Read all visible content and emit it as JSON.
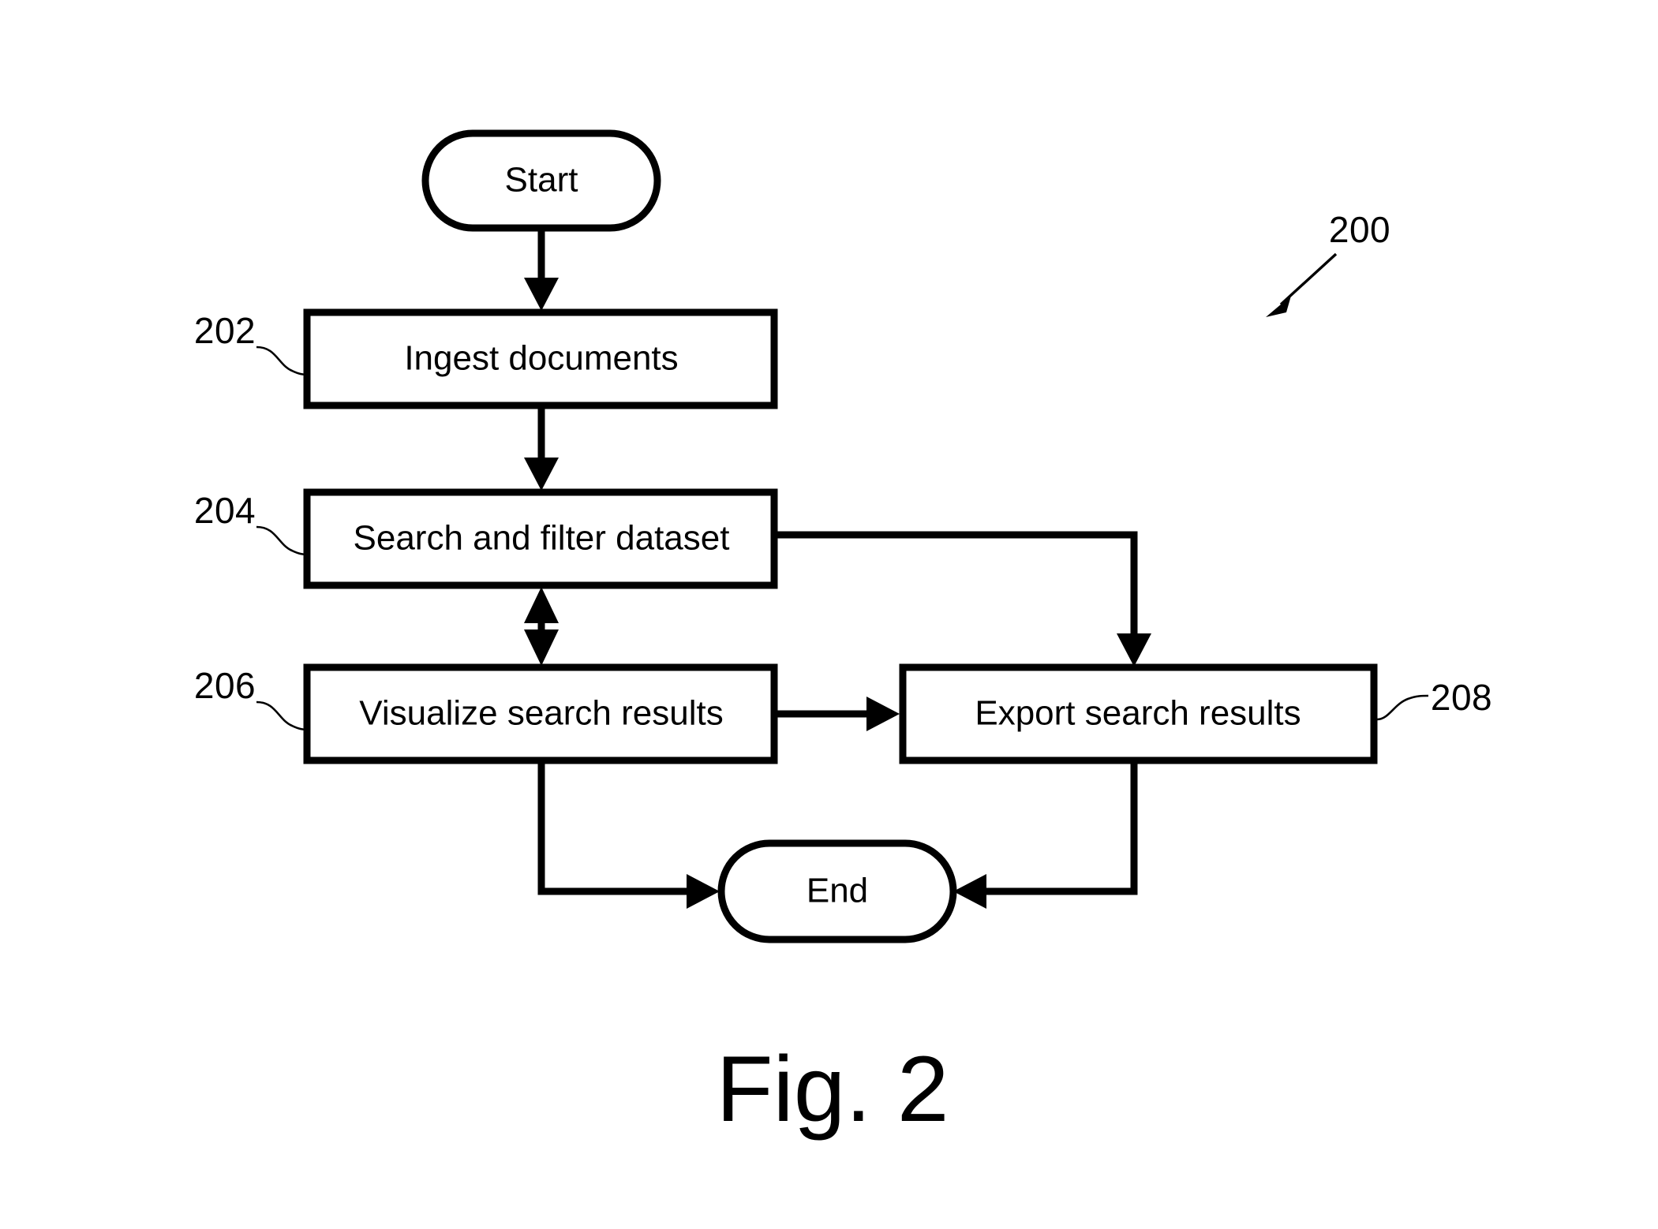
{
  "figure": {
    "caption": "Fig. 2",
    "overall_ref": "200"
  },
  "chart_data": {
    "type": "diagram",
    "diagram_kind": "flowchart",
    "title": "Fig. 2",
    "overall_reference_numeral": "200",
    "nodes": [
      {
        "id": "start",
        "label": "Start",
        "shape": "terminator",
        "ref": ""
      },
      {
        "id": "s202",
        "label": "Ingest documents",
        "shape": "process",
        "ref": "202"
      },
      {
        "id": "s204",
        "label": "Search and filter dataset",
        "shape": "process",
        "ref": "204"
      },
      {
        "id": "s206",
        "label": "Visualize search results",
        "shape": "process",
        "ref": "206"
      },
      {
        "id": "s208",
        "label": "Export search results",
        "shape": "process",
        "ref": "208"
      },
      {
        "id": "end",
        "label": "End",
        "shape": "terminator",
        "ref": ""
      }
    ],
    "edges": [
      {
        "from": "start",
        "to": "s202",
        "direction": "down",
        "arrows": "single"
      },
      {
        "from": "s202",
        "to": "s204",
        "direction": "down",
        "arrows": "single"
      },
      {
        "from": "s204",
        "to": "s206",
        "direction": "vertical",
        "arrows": "double"
      },
      {
        "from": "s204",
        "to": "s208",
        "direction": "right-then-down",
        "arrows": "single"
      },
      {
        "from": "s206",
        "to": "s208",
        "direction": "right",
        "arrows": "single"
      },
      {
        "from": "s206",
        "to": "end",
        "direction": "down-then-right",
        "arrows": "single"
      },
      {
        "from": "s208",
        "to": "end",
        "direction": "down-then-left",
        "arrows": "single"
      }
    ]
  },
  "nodes": {
    "start": {
      "label": "Start"
    },
    "step_202": {
      "label": "Ingest documents",
      "ref": "202"
    },
    "step_204": {
      "label": "Search and filter dataset",
      "ref": "204"
    },
    "step_206": {
      "label": "Visualize search results",
      "ref": "206"
    },
    "step_208": {
      "label": "Export search results",
      "ref": "208"
    },
    "end": {
      "label": "End"
    }
  },
  "colors": {
    "stroke": "#000000",
    "fill": "#ffffff",
    "background": "#ffffff"
  }
}
